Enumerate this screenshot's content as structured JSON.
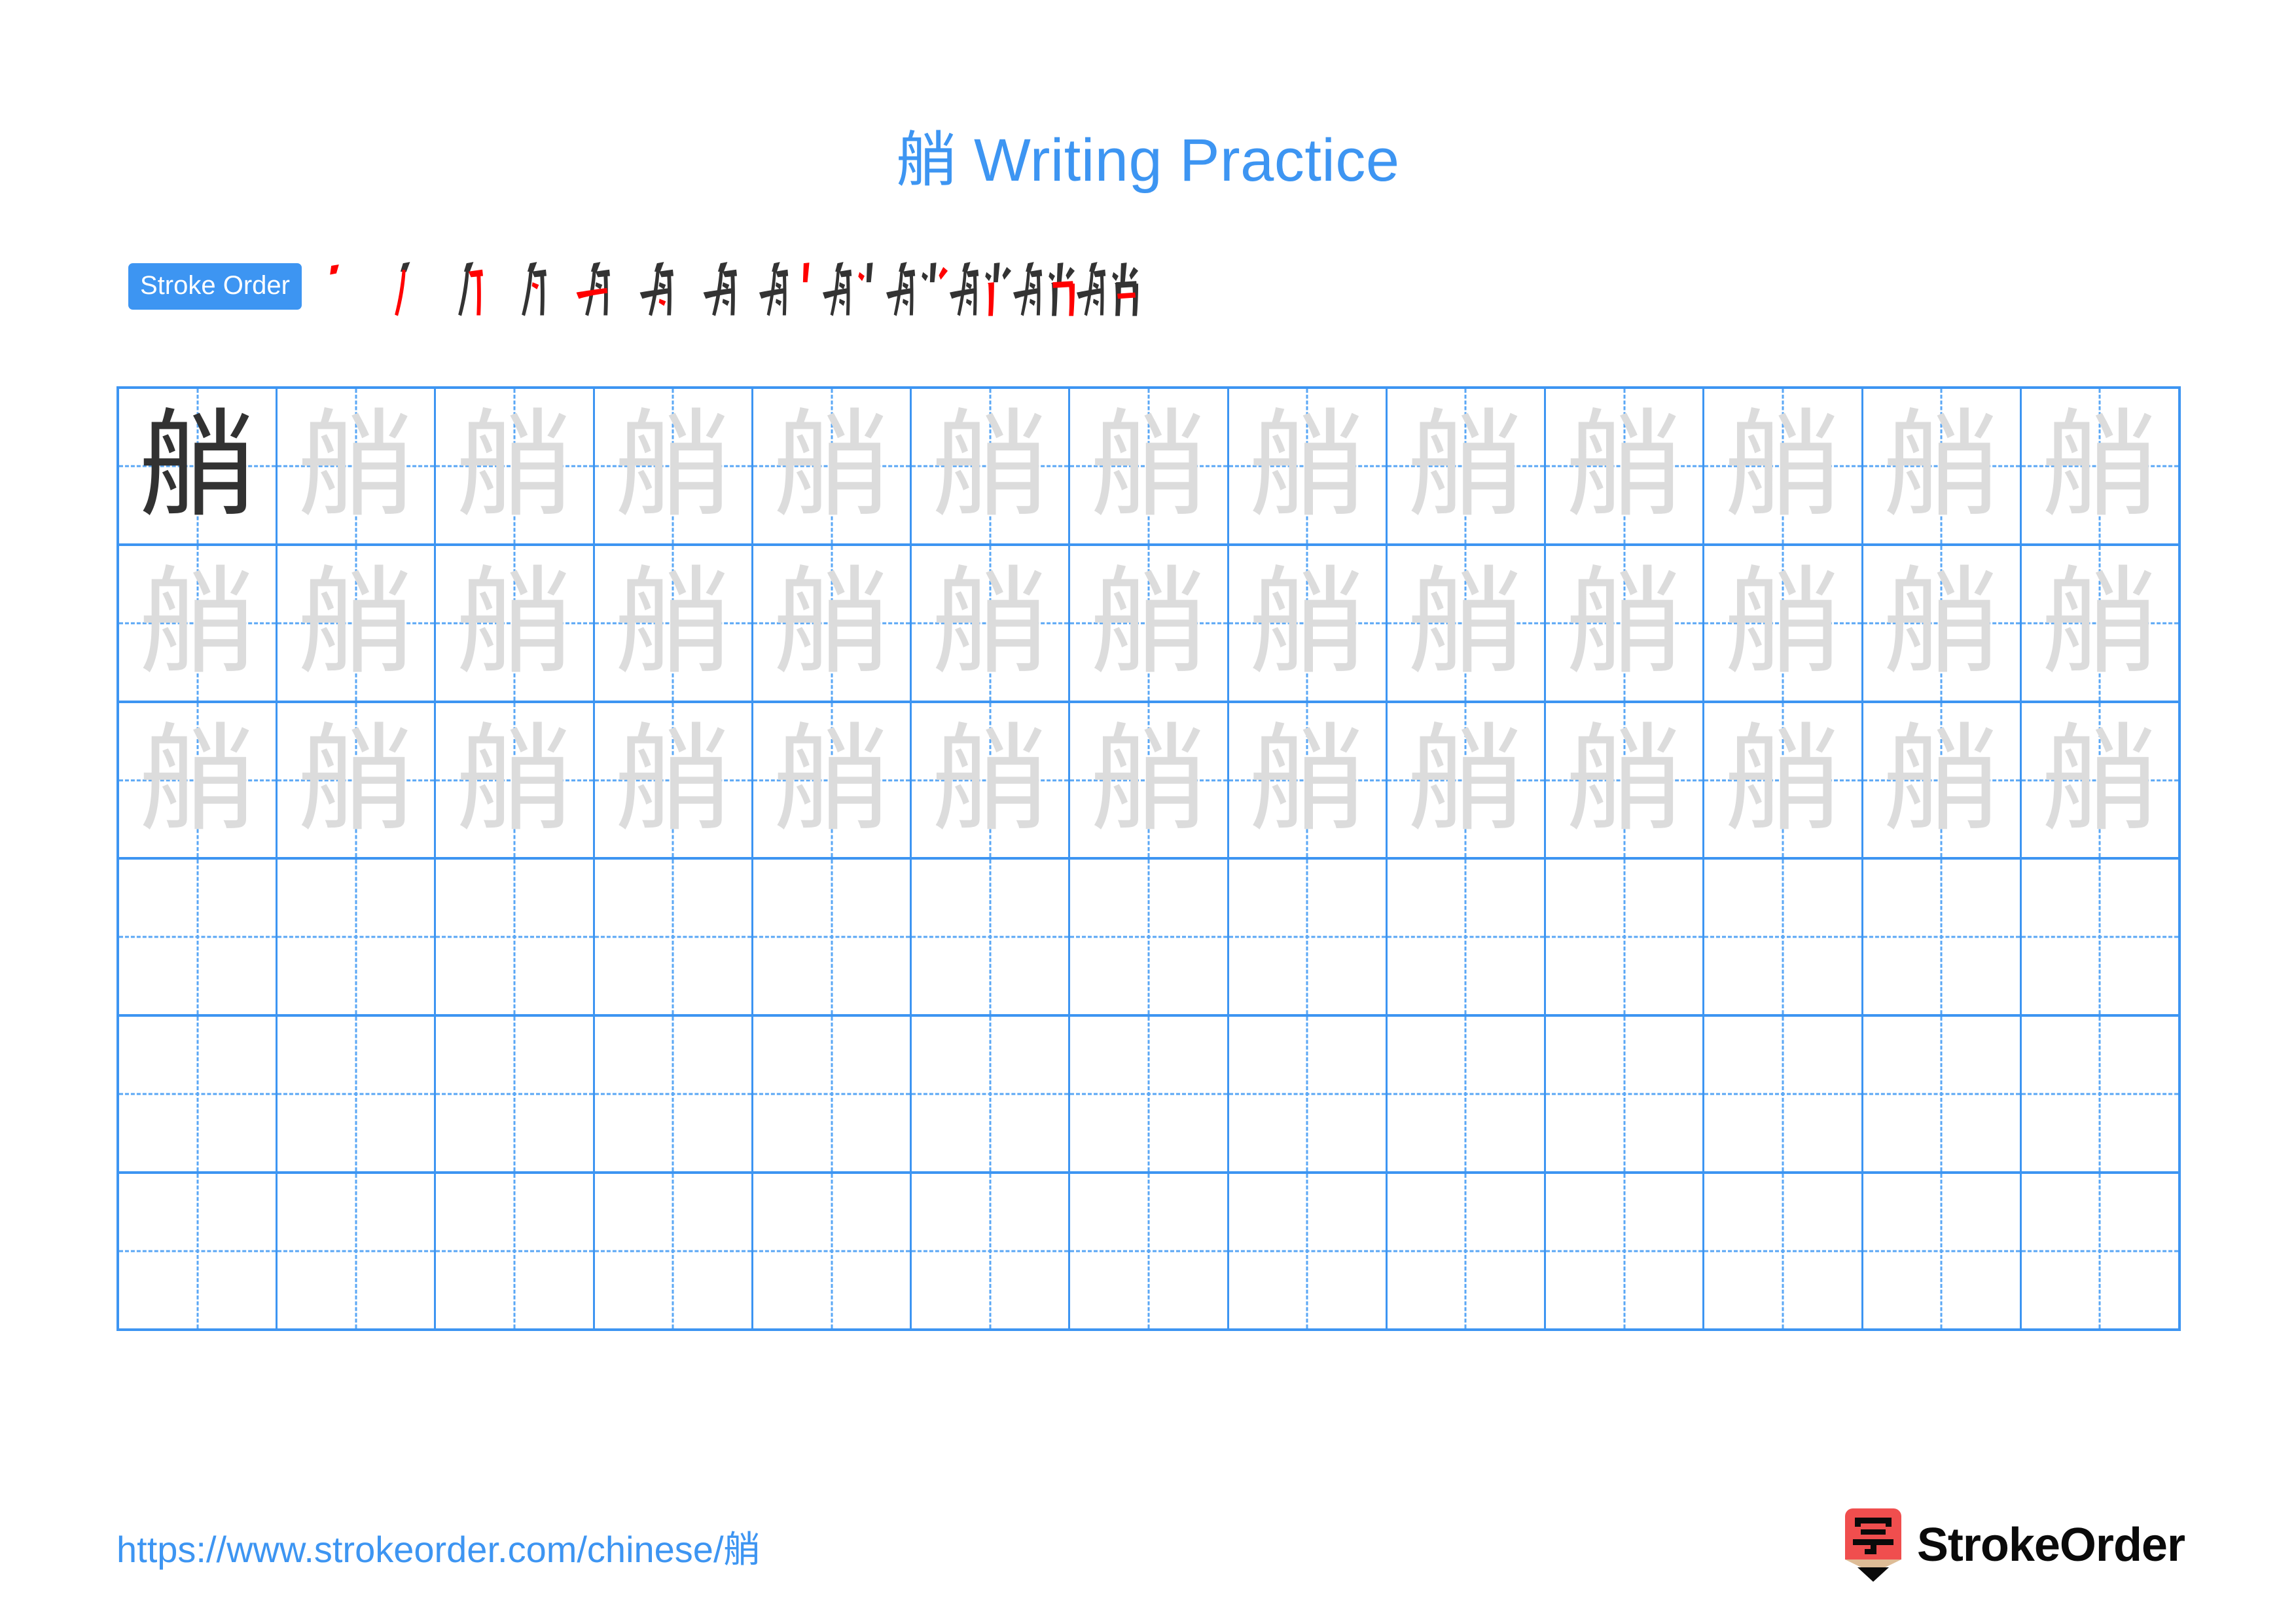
{
  "character": "艄",
  "title": "艄 Writing Practice",
  "colors": {
    "accent": "#3d95f2",
    "grid_line": "#3d95f2",
    "guide_line": "#5aa7f5",
    "trace_char": "#dcdcdc",
    "solid_char": "#323232",
    "stroke_done": "#333333",
    "stroke_current": "#ff0000",
    "logo_red": "#f04e4e",
    "logo_wood": "#debc96"
  },
  "stroke_order": {
    "badge_label": "Stroke Order",
    "total_strokes": 13,
    "steps": [
      {
        "index": 1,
        "partial": "丿"
      },
      {
        "index": 2,
        "partial": "丿"
      },
      {
        "index": 3,
        "partial": "刀"
      },
      {
        "index": 4,
        "partial": "月"
      },
      {
        "index": 5,
        "partial": "𠂇"
      },
      {
        "index": 6,
        "partial": "角"
      },
      {
        "index": 7,
        "partial": "舟"
      },
      {
        "index": 8,
        "partial": "舟丨"
      },
      {
        "index": 9,
        "partial": "舟丶"
      },
      {
        "index": 10,
        "partial": "舟丷"
      },
      {
        "index": 11,
        "partial": "舡"
      },
      {
        "index": 12,
        "partial": "航"
      },
      {
        "index": 13,
        "partial": "艄"
      }
    ]
  },
  "practice_grid": {
    "columns": 13,
    "rows": 6,
    "traced_rows": 3,
    "blank_rows": 3,
    "first_cell_solid": true
  },
  "footer": {
    "url": "https://www.strokeorder.com/chinese/艄",
    "brand_name": "StrokeOrder",
    "brand_icon_char": "字"
  }
}
